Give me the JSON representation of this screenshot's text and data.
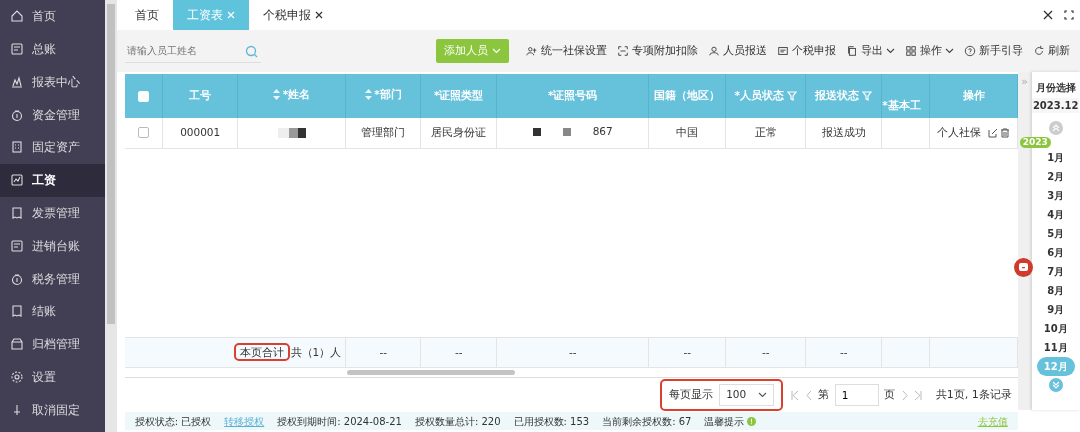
{
  "sidebar": {
    "items": [
      {
        "label": "首页",
        "selected": false
      },
      {
        "label": "总账",
        "selected": false
      },
      {
        "label": "报表中心",
        "selected": false
      },
      {
        "label": "资金管理",
        "selected": false
      },
      {
        "label": "固定资产",
        "selected": false
      },
      {
        "label": "工资",
        "selected": true
      },
      {
        "label": "发票管理",
        "selected": false
      },
      {
        "label": "进销台账",
        "selected": false
      },
      {
        "label": "税务管理",
        "selected": false
      },
      {
        "label": "结账",
        "selected": false
      },
      {
        "label": "归档管理",
        "selected": false
      },
      {
        "label": "设置",
        "selected": false
      }
    ],
    "footer_item": {
      "label": "取消固定"
    }
  },
  "tabs": [
    {
      "label": "首页",
      "selected": false,
      "closable": false
    },
    {
      "label": "工资表",
      "selected": true,
      "closable": true
    },
    {
      "label": "个税申报",
      "selected": false,
      "closable": true
    }
  ],
  "toolbar": {
    "search": {
      "placeholder": "请输入员工姓名"
    },
    "add_button": {
      "label": "添加人员"
    },
    "actions": [
      {
        "label": "统一社保设置",
        "dropdown": false
      },
      {
        "label": "专项附加扣除",
        "dropdown": false
      },
      {
        "label": "人员报送",
        "dropdown": false
      },
      {
        "label": "个税申报",
        "dropdown": false
      },
      {
        "label": "导出",
        "dropdown": true
      },
      {
        "label": "操作",
        "dropdown": true
      },
      {
        "label": "新手引导",
        "dropdown": false
      },
      {
        "label": "刷新",
        "dropdown": false
      }
    ]
  },
  "table": {
    "all_checked": false,
    "columns": [
      {
        "label": "工号",
        "sortable": false,
        "filterable": false
      },
      {
        "label": "*姓名",
        "sortable": true,
        "filterable": false
      },
      {
        "label": "*部门",
        "sortable": true,
        "filterable": false
      },
      {
        "label": "*证照类型",
        "sortable": false,
        "filterable": false
      },
      {
        "label": "*证照号码",
        "sortable": false,
        "filterable": false
      },
      {
        "label": "国籍（地区）",
        "sortable": false,
        "filterable": false
      },
      {
        "label": "*人员状态",
        "sortable": false,
        "filterable": true
      },
      {
        "label": "报送状态",
        "sortable": false,
        "filterable": true
      },
      {
        "label": "*基本工",
        "sortable": false,
        "filterable": false
      }
    ],
    "action_column": {
      "label": "操作"
    },
    "rows": [
      {
        "checked": false,
        "cells": [
          {
            "kind": "text",
            "text": "000001"
          },
          {
            "kind": "redacted"
          },
          {
            "kind": "text",
            "text": "管理部门"
          },
          {
            "kind": "text",
            "text": "居民身份证"
          },
          {
            "kind": "masked",
            "text": "867"
          },
          {
            "kind": "text",
            "text": "中国"
          },
          {
            "kind": "text",
            "text": "正常"
          },
          {
            "kind": "text",
            "text": "报送成功"
          },
          {
            "kind": "empty"
          }
        ],
        "action": "个人社保"
      }
    ],
    "summary": {
      "label": "本页合计",
      "highlighted": true,
      "count": "共（1）人",
      "values": [
        "--",
        "--",
        "--",
        "--",
        "--",
        "--"
      ]
    }
  },
  "collapse_button": "»",
  "pagination": {
    "page_size_label": "每页显示",
    "page_size": "100",
    "highlighted": true,
    "page_prefix": "第",
    "page": "1",
    "page_suffix": "页",
    "summary": "共1页, 1条记录"
  },
  "status_bar": {
    "items": [
      {
        "kind": "text",
        "text": "授权状态: 已授权"
      },
      {
        "kind": "link",
        "text": "转移授权"
      },
      {
        "kind": "text",
        "text": "授权到期时间: 2024-08-21"
      },
      {
        "kind": "text",
        "text": "授权数量总计: 220"
      },
      {
        "kind": "text",
        "text": "已用授权数: 153"
      },
      {
        "kind": "text",
        "text": "当前剩余授权数: 67"
      },
      {
        "kind": "hint",
        "text": "温馨提示"
      }
    ],
    "action": "去充值"
  },
  "month_picker": {
    "title": "月份选择",
    "current": "2023.12",
    "year": "2023",
    "months": [
      {
        "label": "1月",
        "selected": false
      },
      {
        "label": "2月",
        "selected": false
      },
      {
        "label": "3月",
        "selected": false
      },
      {
        "label": "4月",
        "selected": false
      },
      {
        "label": "5月",
        "selected": false
      },
      {
        "label": "6月",
        "selected": false
      },
      {
        "label": "7月",
        "selected": false
      },
      {
        "label": "8月",
        "selected": false
      },
      {
        "label": "9月",
        "selected": false
      },
      {
        "label": "10月",
        "selected": false
      },
      {
        "label": "11月",
        "selected": false
      },
      {
        "label": "12月",
        "selected": true
      }
    ]
  }
}
